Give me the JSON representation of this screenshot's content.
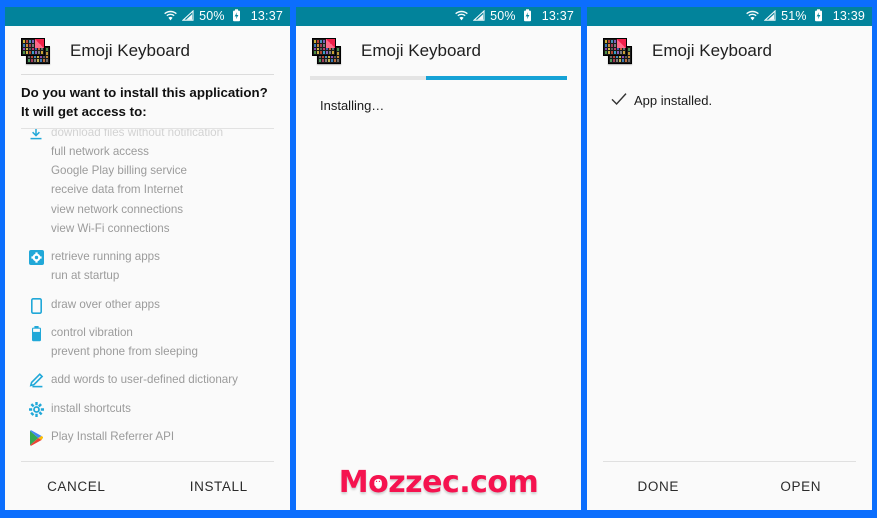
{
  "theme": {
    "frame_blue": "#0b6efd",
    "statusbar_teal": "#02839b",
    "accent_cyan": "#16a2d6",
    "screen_bg": "#fafafa",
    "muted_text": "#9b9b9b",
    "watermark_pink": "#f5134f"
  },
  "panels": [
    {
      "id": "permissions",
      "status_bar": {
        "battery_percent": "50%",
        "time": "13:37",
        "wifi_icon": "wifi-icon",
        "signal_icon": "signal-bars-icon",
        "battery_icon": "battery-charging-icon"
      },
      "app_title": "Emoji Keyboard",
      "app_icon": "emoji-keyboard-app-icon",
      "question": "Do you want to install this application? It will get access to:",
      "permission_groups": [
        {
          "icon": "download-icon",
          "items": [
            "download files without notification",
            "full network access",
            "Google Play billing service",
            "receive data from Internet",
            "view network connections",
            "view Wi-Fi connections"
          ]
        },
        {
          "icon": "running-apps-icon",
          "items": [
            "retrieve running apps",
            "run at startup"
          ]
        },
        {
          "icon": "phone-overlay-icon",
          "items": [
            "draw over other apps"
          ]
        },
        {
          "icon": "battery-icon",
          "items": [
            "control vibration",
            "prevent phone from sleeping"
          ]
        },
        {
          "icon": "pencil-icon",
          "items": [
            "add words to user-defined dictionary"
          ]
        },
        {
          "icon": "gear-icon",
          "items": [
            "install shortcuts"
          ]
        },
        {
          "icon": "google-play-icon",
          "items": [
            "Play Install Referrer API"
          ]
        }
      ],
      "buttons": {
        "left": "CANCEL",
        "right": "INSTALL"
      }
    },
    {
      "id": "installing",
      "status_bar": {
        "battery_percent": "50%",
        "time": "13:37",
        "wifi_icon": "wifi-icon",
        "signal_icon": "signal-bars-icon",
        "battery_icon": "battery-charging-icon"
      },
      "app_title": "Emoji Keyboard",
      "app_icon": "emoji-keyboard-app-icon",
      "progress_percent": 55,
      "status_text": "Installing…",
      "watermark": "Mozzec.com"
    },
    {
      "id": "installed",
      "status_bar": {
        "battery_percent": "51%",
        "time": "13:39",
        "wifi_icon": "wifi-icon",
        "signal_icon": "signal-bars-icon",
        "battery_icon": "battery-charging-icon"
      },
      "app_title": "Emoji Keyboard",
      "app_icon": "emoji-keyboard-app-icon",
      "status_text": "App installed.",
      "check_icon": "check-icon",
      "buttons": {
        "left": "DONE",
        "right": "OPEN"
      }
    }
  ]
}
